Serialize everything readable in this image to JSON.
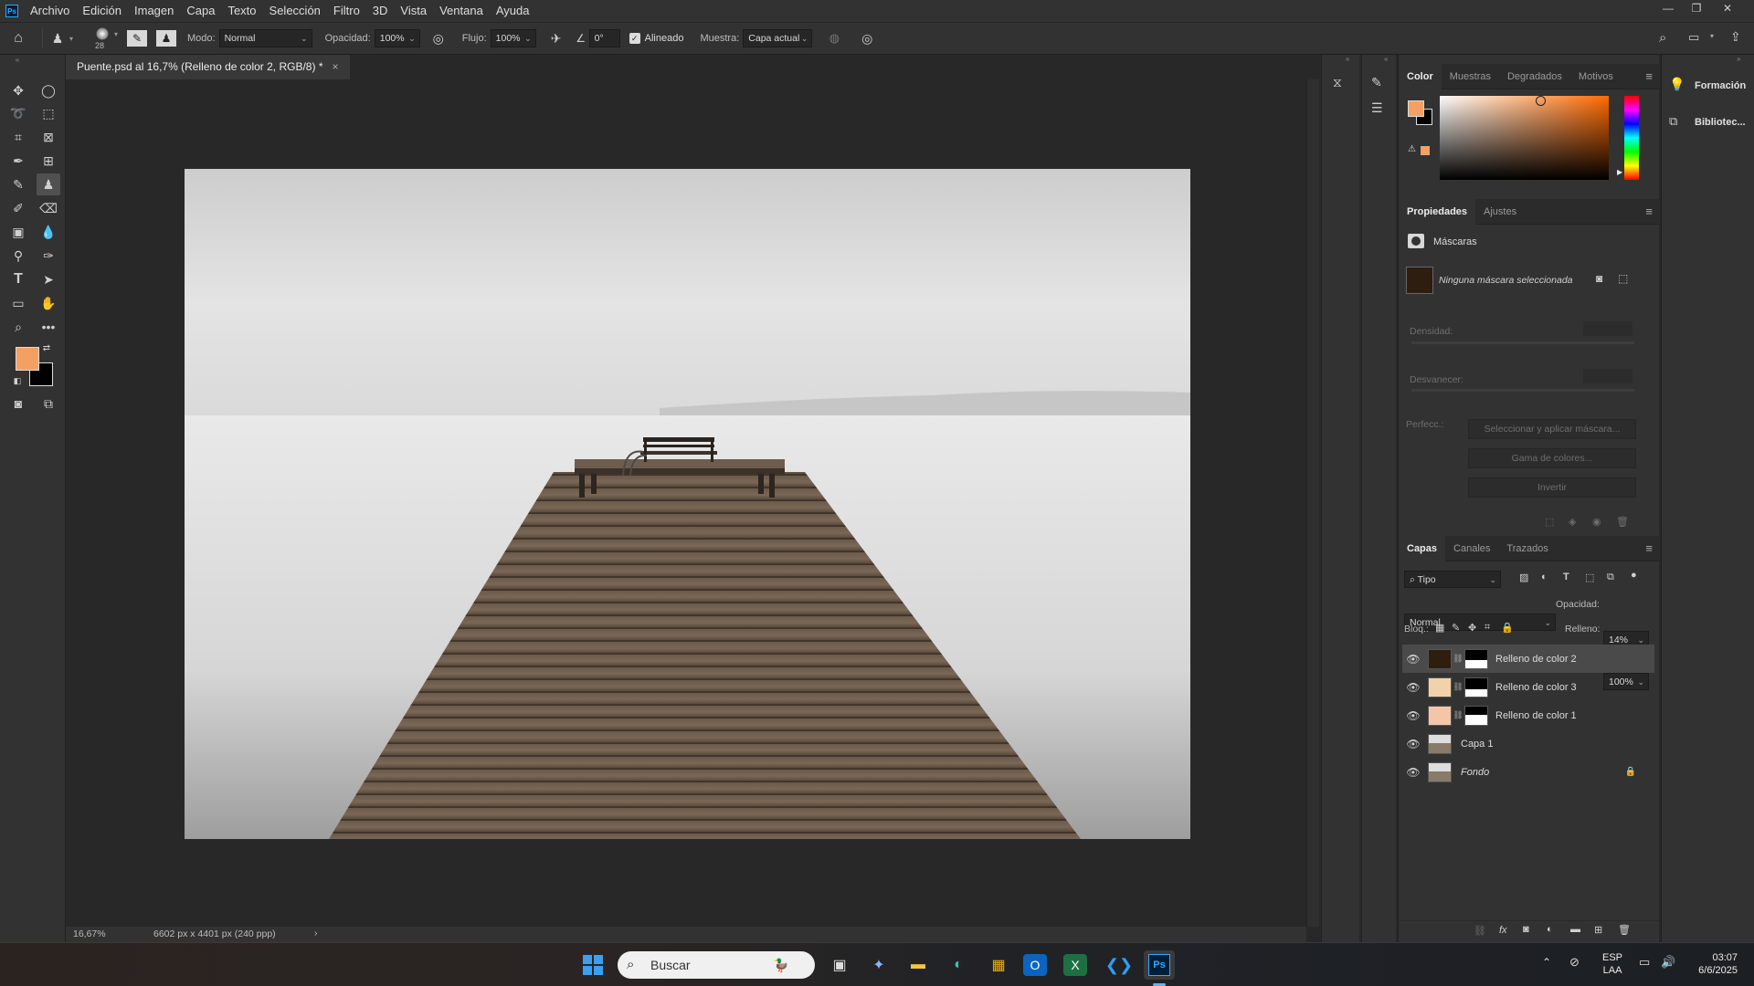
{
  "app": {
    "logo": "Ps"
  },
  "menu": [
    "Archivo",
    "Edición",
    "Imagen",
    "Capa",
    "Texto",
    "Selección",
    "Filtro",
    "3D",
    "Vista",
    "Ventana",
    "Ayuda"
  ],
  "options": {
    "brush_size": "28",
    "mode_label": "Modo:",
    "mode_value": "Normal",
    "opacity_label": "Opacidad:",
    "opacity_value": "100%",
    "flow_label": "Flujo:",
    "flow_value": "100%",
    "angle_value": "0°",
    "aligned_label": "Alineado",
    "sample_label": "Muestra:",
    "sample_value": "Capa actual"
  },
  "document": {
    "tab_title": "Puente.psd al 16,7% (Relleno de color 2, RGB/8) *",
    "close": "×"
  },
  "status": {
    "zoom": "16,67%",
    "dims": "6602 px x 4401 px (240 ppp)",
    "arrow": "›"
  },
  "color_panel": {
    "tabs": [
      "Color",
      "Muestras",
      "Degradados",
      "Motivos"
    ],
    "fg_color": "#f4a062",
    "bg_color": "#000000",
    "hue_color": "#ff6a00"
  },
  "properties_panel": {
    "tabs": [
      "Propiedades",
      "Ajustes"
    ],
    "section": "Máscaras",
    "no_mask": "Ninguna máscara seleccionada",
    "density_label": "Densidad:",
    "feather_label": "Desvanecer:",
    "refine_label": "Perfecc.:",
    "btn_select_mask": "Seleccionar y aplicar máscara...",
    "btn_color_range": "Gama de colores...",
    "btn_invert": "Invertir"
  },
  "layers_panel": {
    "tabs": [
      "Capas",
      "Canales",
      "Trazados"
    ],
    "filter_value": "Tipo",
    "blend_mode": "Normal",
    "opacity_label": "Opacidad:",
    "opacity_value": "14%",
    "lock_label": "Bloq.:",
    "fill_label": "Relleno:",
    "fill_value": "100%",
    "layers": [
      {
        "name": "Relleno de color 2",
        "color": "#2e1e10",
        "selected": true
      },
      {
        "name": "Relleno de color 3",
        "color": "#f2d2a8",
        "selected": false
      },
      {
        "name": "Relleno de color 1",
        "color": "#f3c6a8",
        "selected": false
      },
      {
        "name": "Capa 1",
        "color": "",
        "selected": false
      },
      {
        "name": "Fondo",
        "color": "",
        "selected": false
      }
    ]
  },
  "right_panel": {
    "learn": "Formación",
    "libraries": "Bibliotec..."
  },
  "taskbar": {
    "search_placeholder": "Buscar",
    "lang_top": "ESP",
    "lang_bottom": "LAA",
    "time": "03:07",
    "date": "6/6/2025"
  }
}
